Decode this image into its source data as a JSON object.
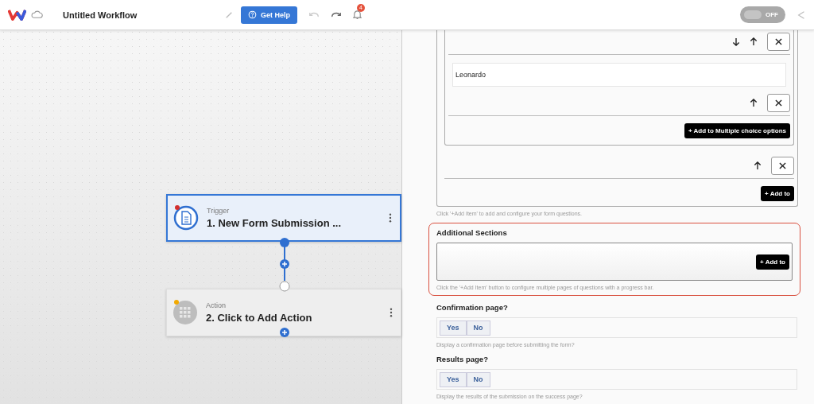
{
  "header": {
    "title": "Untitled Workflow",
    "help_button": "Get Help",
    "notification_count": "4",
    "toggle": {
      "label": "OFF",
      "on": false
    }
  },
  "canvas": {
    "nodes": [
      {
        "kind": "trigger",
        "label": "Trigger",
        "title": "1. New Form Submission ...",
        "selected": true,
        "color": "#d32f2f"
      },
      {
        "kind": "action",
        "label": "Action",
        "title": "2. Click to Add Action",
        "selected": false,
        "color": "#f2a900"
      }
    ]
  },
  "panel": {
    "inner_rows": [
      {
        "kind": "controls"
      },
      {
        "kind": "option",
        "field": "Leonardo"
      }
    ],
    "inner_add_button": "+ Add to Multiple choice options",
    "outer_add_button": "+ Add to",
    "questions_hint": "Click '+Add Item' to add and configure your form questions.",
    "additional_sections": {
      "title": "Additional Sections",
      "add_button": "+ Add to",
      "hint": "Click the '+Add Item' button to configure multiple pages of questions with a progress bar.",
      "highlighted": true
    },
    "toggles": [
      {
        "title": "Confirmation page?",
        "options": [
          "Yes",
          "No"
        ],
        "hint": "Display a confirmation page before submitting the form?"
      },
      {
        "title": "Results page?",
        "options": [
          "Yes",
          "No"
        ],
        "hint": "Display the results of the submission on the success page?"
      }
    ]
  }
}
